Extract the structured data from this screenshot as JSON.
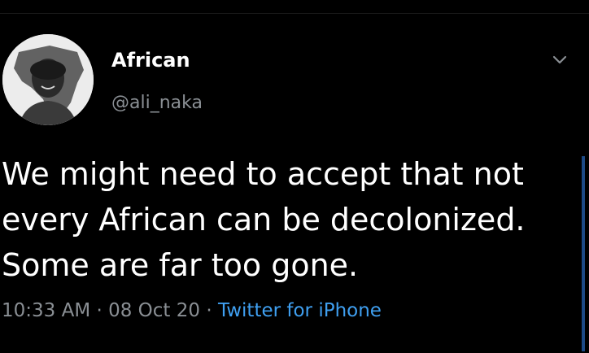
{
  "tweet": {
    "author": {
      "display_name": "African",
      "handle": "@ali_naka",
      "avatar_icon": "profile-avatar"
    },
    "menu_icon": "chevron-down-icon",
    "text_lines": [
      "We might need to accept that not",
      "every African can be decolonized.",
      "Some are far too gone."
    ],
    "time": "10:33 AM",
    "date": "08 Oct 20",
    "separator": "·",
    "source": "Twitter for iPhone"
  },
  "colors": {
    "background": "#000000",
    "text": "#ffffff",
    "muted": "#8a8f94",
    "link": "#3f9ff0"
  }
}
